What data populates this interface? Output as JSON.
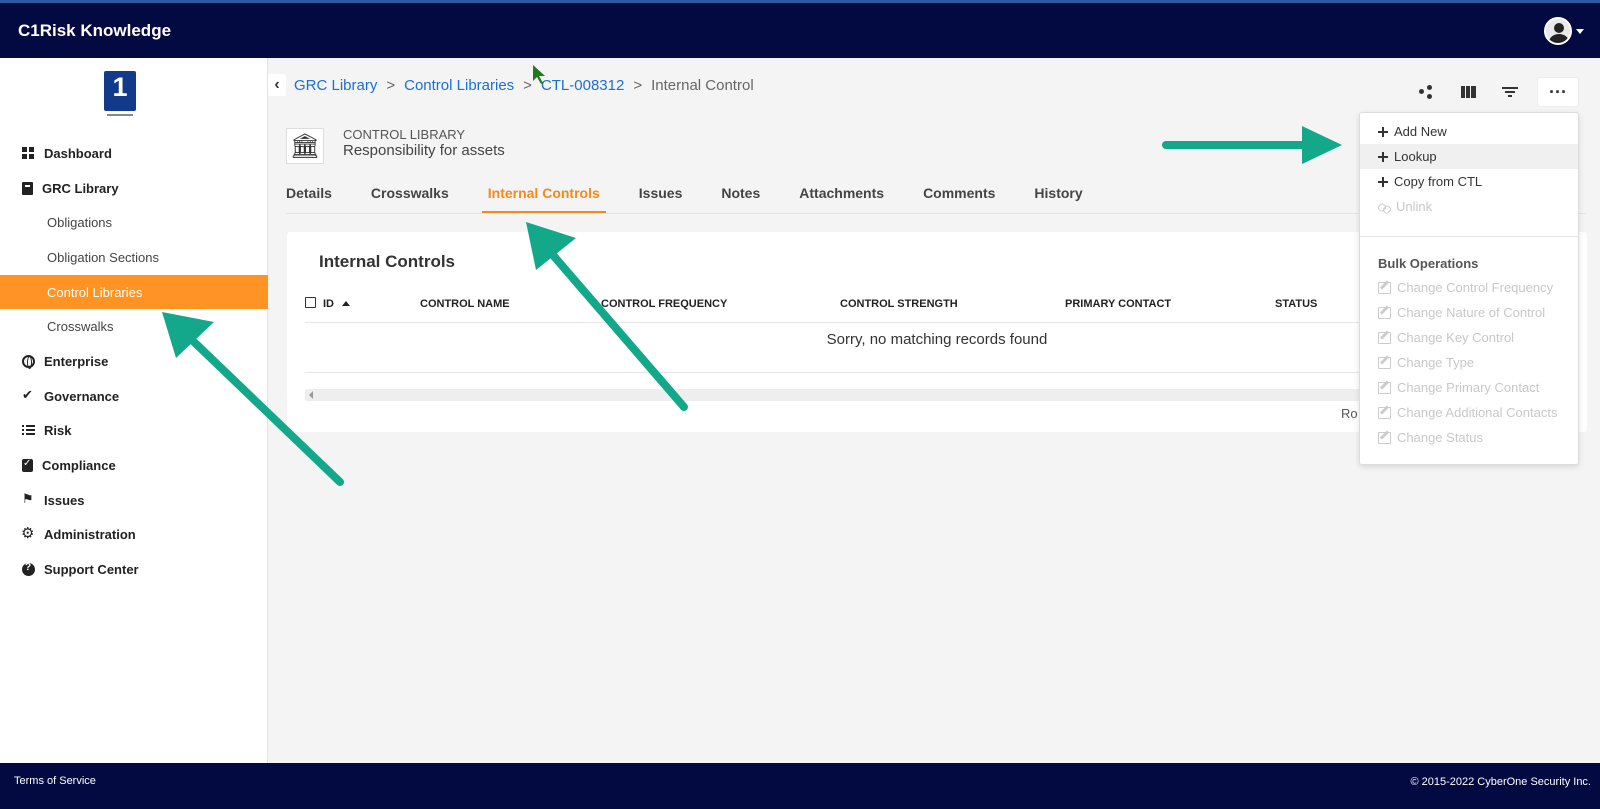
{
  "header": {
    "app_title": "C1Risk Knowledge"
  },
  "sidebar": {
    "items": [
      {
        "label": "Dashboard",
        "icon": "dashboard-icon"
      },
      {
        "label": "GRC Library",
        "icon": "book-icon"
      },
      {
        "label": "Obligations"
      },
      {
        "label": "Obligation Sections"
      },
      {
        "label": "Control Libraries",
        "active": true
      },
      {
        "label": "Crosswalks"
      },
      {
        "label": "Enterprise",
        "icon": "globe-icon"
      },
      {
        "label": "Governance",
        "icon": "check-double-icon"
      },
      {
        "label": "Risk",
        "icon": "list-icon"
      },
      {
        "label": "Compliance",
        "icon": "clipboard-check-icon"
      },
      {
        "label": "Issues",
        "icon": "flag-icon"
      },
      {
        "label": "Administration",
        "icon": "gear-icon"
      },
      {
        "label": "Support Center",
        "icon": "question-circle-icon"
      }
    ]
  },
  "breadcrumb": {
    "items": [
      "GRC Library",
      "Control Libraries",
      "CTL-008312"
    ],
    "separator": ">",
    "current": "Internal Control"
  },
  "library": {
    "type": "CONTROL LIBRARY",
    "name": "Responsibility for assets",
    "icon": "bank-icon"
  },
  "tabs": [
    {
      "label": "Details"
    },
    {
      "label": "Crosswalks"
    },
    {
      "label": "Internal Controls",
      "active": true
    },
    {
      "label": "Issues"
    },
    {
      "label": "Notes"
    },
    {
      "label": "Attachments"
    },
    {
      "label": "Comments"
    },
    {
      "label": "History"
    }
  ],
  "table": {
    "title": "Internal Controls",
    "columns": [
      "ID",
      "CONTROL NAME",
      "CONTROL FREQUENCY",
      "CONTROL STRENGTH",
      "PRIMARY CONTACT",
      "STATUS"
    ],
    "empty_message": "Sorry, no matching records found",
    "rows_label": "Ro"
  },
  "dropdown": {
    "items": [
      {
        "label": "Add New",
        "icon": "plus-icon"
      },
      {
        "label": "Lookup",
        "icon": "plus-icon",
        "hovered": true
      },
      {
        "label": "Copy from CTL",
        "icon": "plus-icon"
      },
      {
        "label": "Unlink",
        "icon": "unlink-icon",
        "disabled": true
      }
    ],
    "bulk_heading": "Bulk Operations",
    "bulk_items": [
      "Change Control Frequency",
      "Change Nature of Control",
      "Change Key Control",
      "Change Type",
      "Change Primary Contact",
      "Change Additional Contacts",
      "Change Status"
    ]
  },
  "footer": {
    "terms": "Terms of Service",
    "copyright": "© 2015-2022 CyberOne Security Inc."
  },
  "colors": {
    "topbar": "#030a42",
    "accent_orange": "#ff9424",
    "link_blue": "#1a6fd6",
    "annotation_arrow": "#13a88a"
  }
}
